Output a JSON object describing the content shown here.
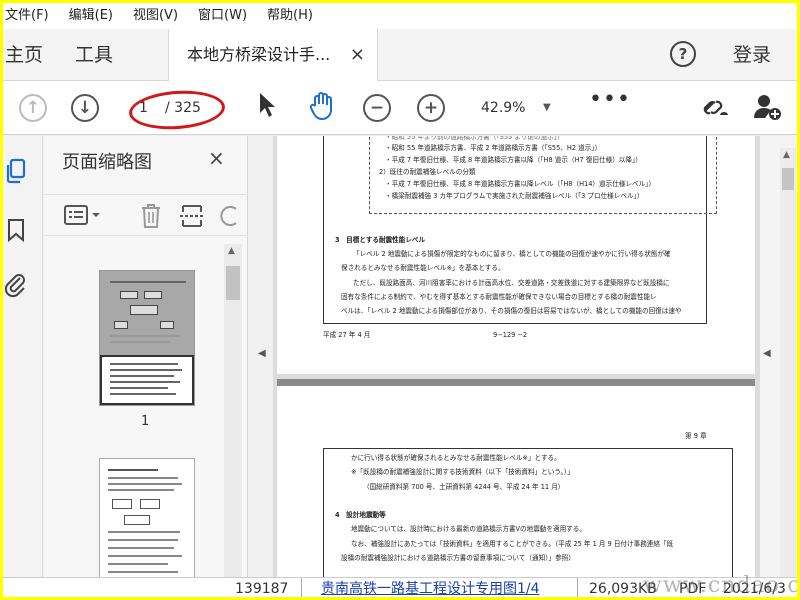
{
  "menu": {
    "items": [
      "文件(F)",
      "编辑(E)",
      "视图(V)",
      "窗口(W)",
      "帮助(H)"
    ]
  },
  "tabs": {
    "home": "主页",
    "tools": "工具",
    "document": "本地方桥梁设计手...",
    "close": "×",
    "help": "?",
    "login": "登录"
  },
  "toolbar": {
    "page_current": "1",
    "page_total": "/ 325",
    "zoom": "42.9%",
    "icons": [
      "arrow-up-icon",
      "arrow-down-icon",
      "pointer-icon",
      "hand-icon",
      "zoom-out-icon",
      "zoom-in-icon",
      "more-icon",
      "share-link-icon",
      "add-user-icon"
    ]
  },
  "sidebar": {
    "panel_title": "页面缩略图",
    "close": "×",
    "thumbnails": [
      {
        "label": "1"
      },
      {
        "label": ""
      }
    ]
  },
  "document": {
    "page1": {
      "box_lines": [
        "・昭和 55 年道路橋示方書、平成 2 年道路橋示方書（「S55、H2 道示」）",
        "・平成 7 年復旧仕様、平成 8 年道路橋示方書以降（「H8 道示（H7 復旧仕様）以降」）",
        "2）既往の耐震補強レベルの分類",
        "・平成 7 年復旧仕様、平成 8 年道路橋示方書以降レベル（「H8（H14）道示仕様レベル」）",
        "・橋梁耐震補強 3 カ年プログラムで実施された耐震補強レベル（「3 プロ仕様レベル」）"
      ],
      "heading": "3　目標とする耐震性能レベル",
      "body": [
        "「レベル 2 地震動による損傷が限定的なものに留まり、橋としての機能の回復が速やかに行い得る状態が確",
        "保されるとみなせる耐震性能レベル※」を基本とする。",
        "ただし、既設路面高、河川阻害率における計画高水位、交差道路・交差鉄道に対する建築限界など既設橋に",
        "固有な条件による制約で、やむを得ず基本とする耐震性能が確保できない場合の目標とする橋の耐震性能レ",
        "ベルは、「レベル 2 地震動による損傷部位があり、その損傷の復旧は容易ではないが、橋としての機能の回復は速や"
      ],
      "footer_left": "平成 27 年 4 月",
      "footer_center": "9−129 −2"
    },
    "page2": {
      "chapter": "第 9 章",
      "lines": [
        "かに行い得る状態が確保されるとみなせる耐震性能レベル※」とする。",
        "※「既設橋の耐震補強設計に関する技術資料（以下「技術資料」という。）」",
        "（国総研資料第 700 号、土研資料第 4244 号、平成 24 年 11 月）",
        "4　設計地震動等",
        "地震動については、設計時における最新の道路橋示方書Ⅴの地震動を適用する。",
        "なお、補強設計にあたっては「技術資料」を適用することができる。（平成 25 年 1 月 9 日付け事務連絡「既",
        "設橋の耐震補強設計における道路橋示方書の留意事項について（通知）」参照）"
      ]
    }
  },
  "bottom": {
    "num": "139187",
    "link": "贵南高铁一路基工程设计专用图1/4",
    "size": "26,093KB",
    "type": "PDF",
    "date": "2021/6/3"
  },
  "watermark": "www.cndao.com"
}
